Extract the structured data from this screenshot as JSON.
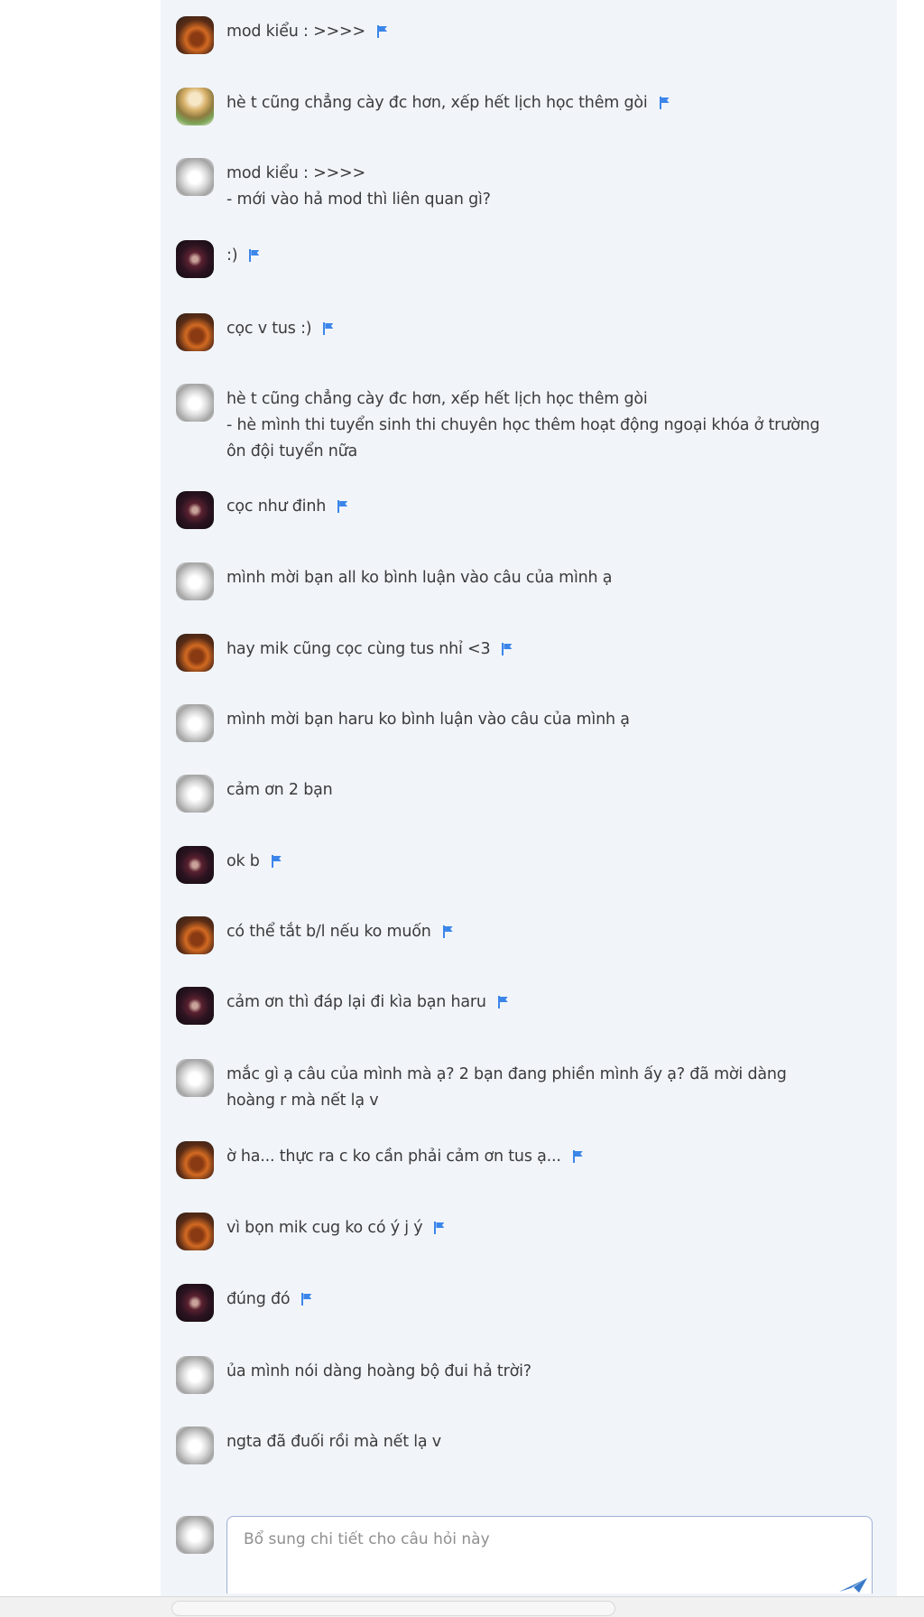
{
  "comments": [
    {
      "avatar": "orange",
      "lines": [
        "mod kiểu : >>>>"
      ],
      "flag": true
    },
    {
      "avatar": "anime",
      "lines": [
        "hè t cũng chẳng cày đc hơn, xếp hết lịch học thêm gòi"
      ],
      "flag": true
    },
    {
      "avatar": "white",
      "lines": [
        "mod kiểu : >>>>",
        "- mới vào hả mod thì liên quan gì?"
      ],
      "flag": false
    },
    {
      "avatar": "dark",
      "lines": [
        ":)"
      ],
      "flag": true
    },
    {
      "avatar": "orange",
      "lines": [
        "cọc v tus :)"
      ],
      "flag": true
    },
    {
      "avatar": "white",
      "lines": [
        "hè t cũng chẳng cày đc hơn, xếp hết lịch học thêm gòi",
        "- hè mình thi tuyển sinh thi chuyên học thêm hoạt động ngoại khóa ở trường",
        "ôn đội tuyển nữa"
      ],
      "flag": false
    },
    {
      "avatar": "dark",
      "lines": [
        "cọc như đinh"
      ],
      "flag": true
    },
    {
      "avatar": "white",
      "lines": [
        "mình mời bạn all ko bình luận vào câu của mình ạ"
      ],
      "flag": false
    },
    {
      "avatar": "orange",
      "lines": [
        "hay mik cũng cọc cùng tus nhỉ <3"
      ],
      "flag": true
    },
    {
      "avatar": "white",
      "lines": [
        "mình mời bạn haru ko bình luận vào câu của mình ạ"
      ],
      "flag": false
    },
    {
      "avatar": "white",
      "lines": [
        "cảm ơn 2 bạn"
      ],
      "flag": false
    },
    {
      "avatar": "dark",
      "lines": [
        "ok b"
      ],
      "flag": true
    },
    {
      "avatar": "orange",
      "lines": [
        "có thể tắt b/l nếu ko muốn"
      ],
      "flag": true
    },
    {
      "avatar": "dark",
      "lines": [
        "cảm ơn thì đáp lại đi kìa bạn haru"
      ],
      "flag": true
    },
    {
      "avatar": "white",
      "lines": [
        "mắc gì ạ câu của mình mà ạ? 2 bạn đang phiền mình ấy ạ? đã mời dàng",
        "hoàng r mà nết lạ v"
      ],
      "flag": false
    },
    {
      "avatar": "orange",
      "lines": [
        "ờ ha... thực ra c ko cần phải cảm ơn tus ạ..."
      ],
      "flag": true
    },
    {
      "avatar": "orange",
      "lines": [
        "vì bọn mik cug ko có ý j ý"
      ],
      "flag": true
    },
    {
      "avatar": "dark",
      "lines": [
        "đúng đó"
      ],
      "flag": true
    },
    {
      "avatar": "white",
      "lines": [
        "ủa mình nói dàng hoàng bộ đui hả trời?"
      ],
      "flag": false
    },
    {
      "avatar": "white",
      "lines": [
        "ngta đã đuối rồi mà nết lạ v"
      ],
      "flag": false
    }
  ],
  "reply": {
    "placeholder": "Bổ sung chi tiết cho câu hỏi này",
    "avatar": "white"
  },
  "icons": {
    "flag": "report-flag-icon",
    "send": "send-icon"
  },
  "colors": {
    "panel": "#f1f5fa",
    "text": "#3b3b3b",
    "flag": "#3c86ea",
    "input_border": "#9eb0d6"
  }
}
